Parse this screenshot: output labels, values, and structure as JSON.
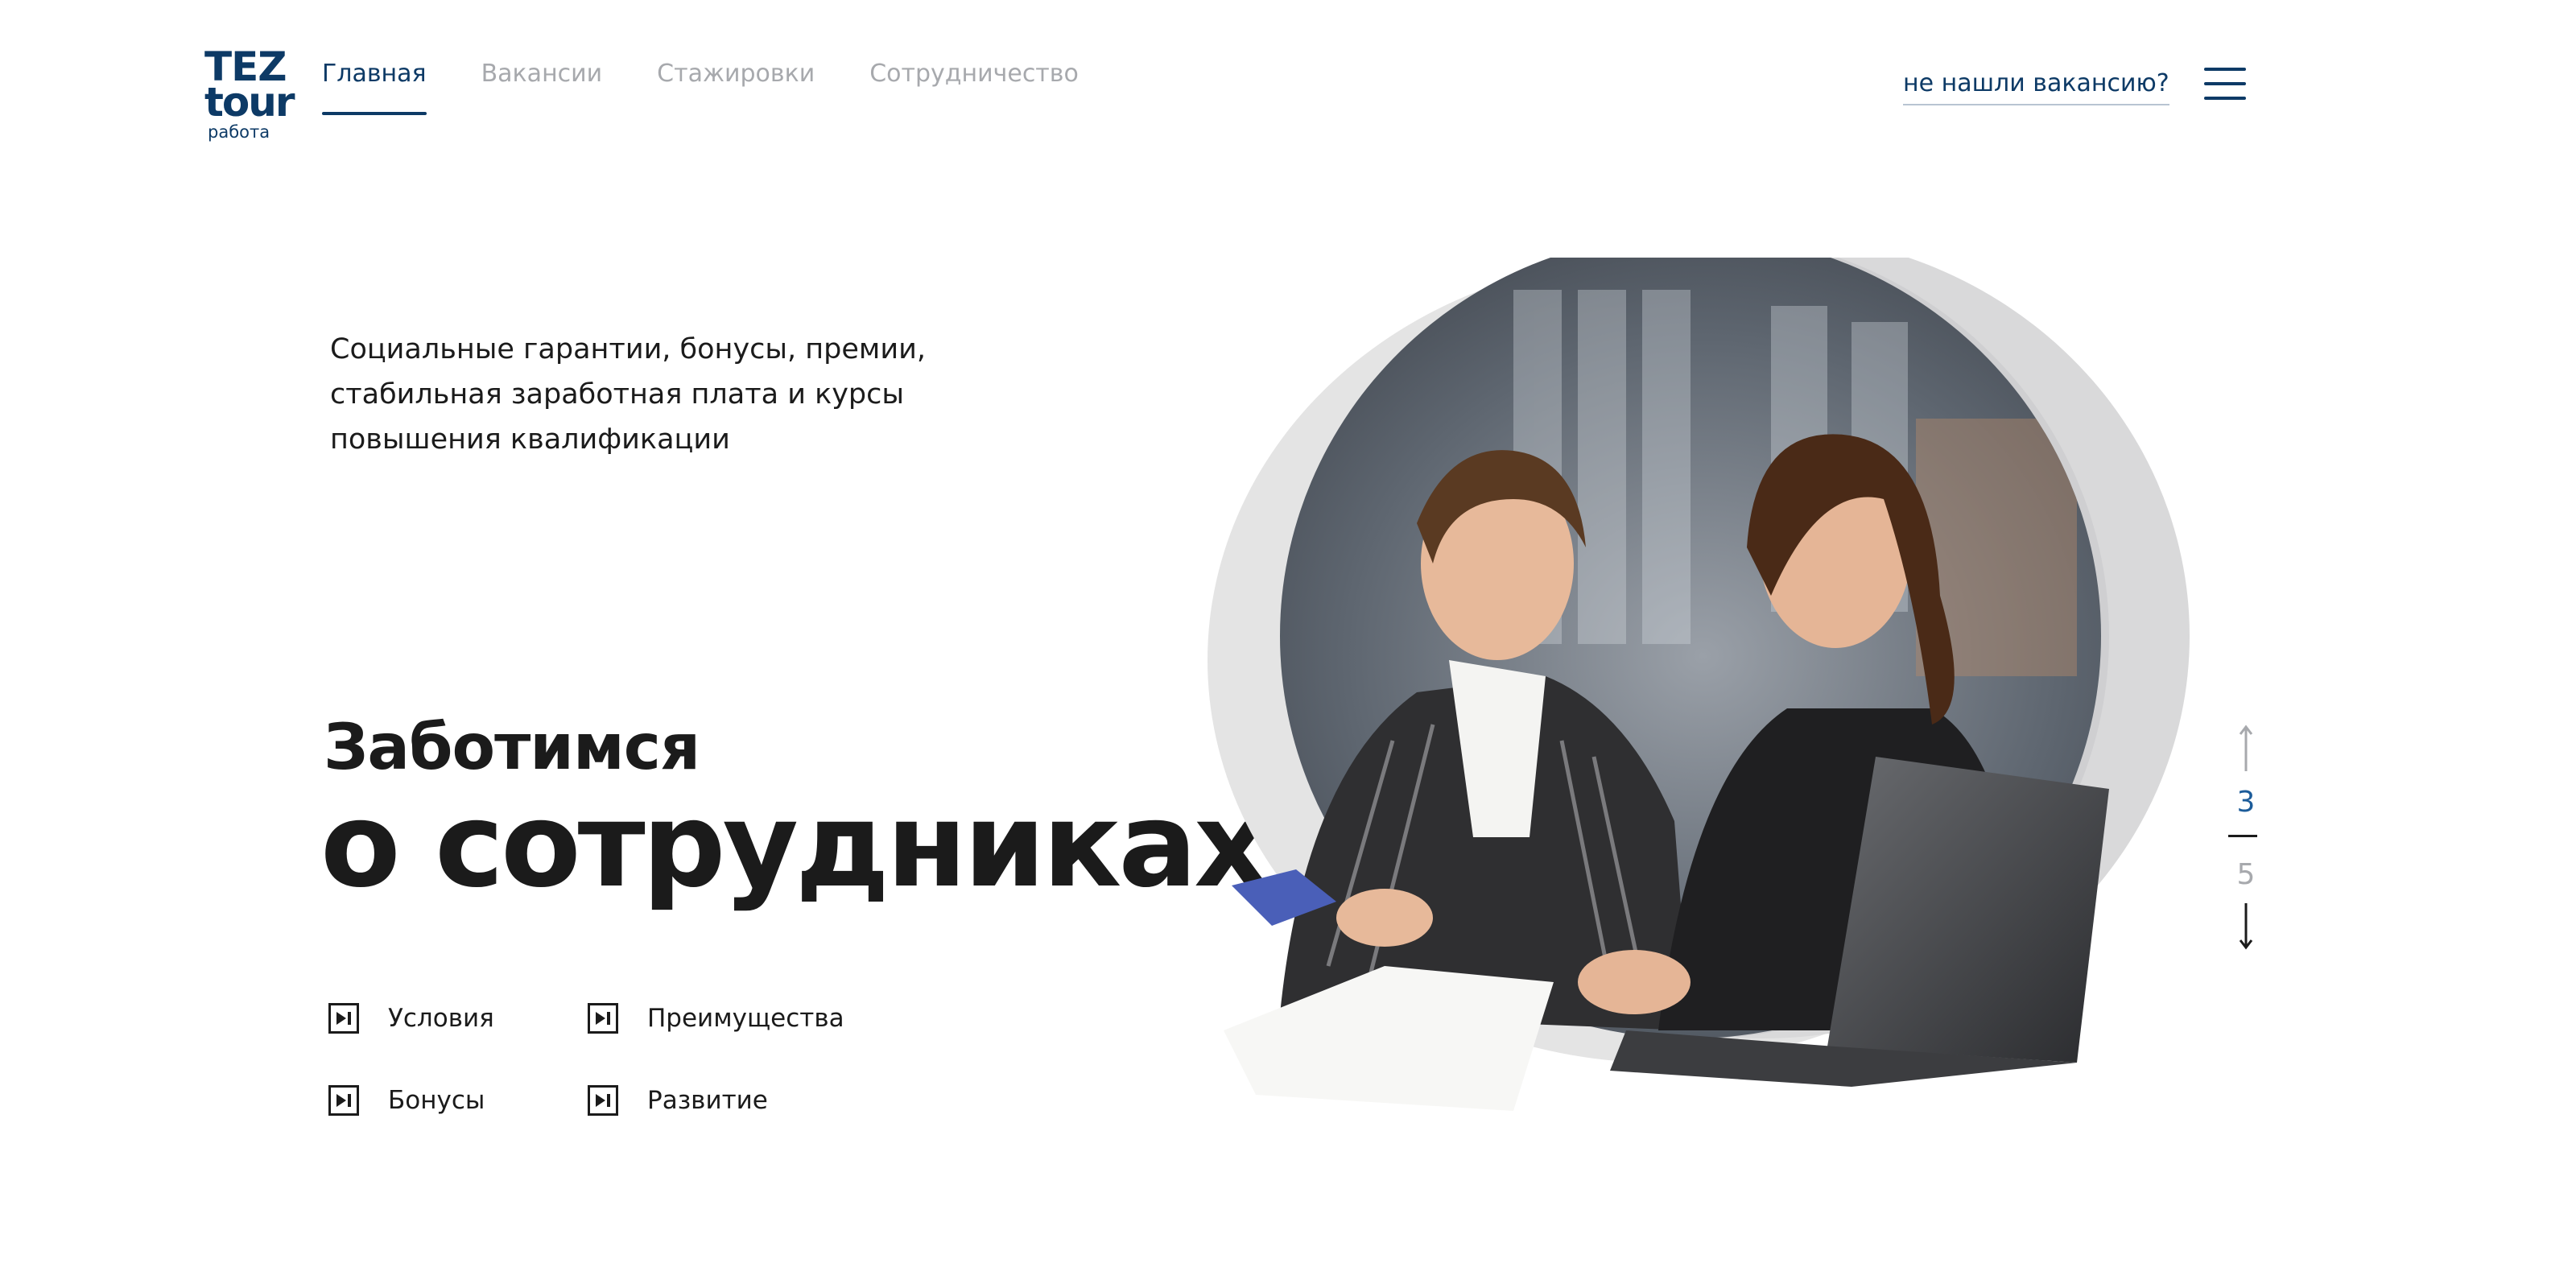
{
  "logo": {
    "line1": "TEZ",
    "line2": "tour",
    "line3": "работа"
  },
  "nav": {
    "items": [
      {
        "label": "Главная",
        "active": true
      },
      {
        "label": "Вакансии",
        "active": false
      },
      {
        "label": "Стажировки",
        "active": false
      },
      {
        "label": "Сотрудничество",
        "active": false
      }
    ]
  },
  "header": {
    "not_found_link": "не нашли вакансию?",
    "menu_icon": "hamburger-menu-icon"
  },
  "hero": {
    "lead": "Социальные гарантии, бонусы, премии,\nстабильная заработная плата и курсы\nповышения квалификации",
    "heading_small": "Заботимся",
    "heading_big": "о сотрудниках",
    "links": [
      {
        "label": "Условия",
        "icon": "play-next-icon"
      },
      {
        "label": "Преимущества",
        "icon": "play-next-icon"
      },
      {
        "label": "Бонусы",
        "icon": "play-next-icon"
      },
      {
        "label": "Развитие",
        "icon": "play-next-icon"
      }
    ],
    "image": "two-businesswomen-with-laptop-photo"
  },
  "pager": {
    "current": "3",
    "total": "5",
    "up_icon": "arrow-up-icon",
    "down_icon": "arrow-down-icon"
  },
  "colors": {
    "brand": "#0d3a66",
    "accent": "#1c5c9a",
    "muted": "#a7a9ad",
    "text": "#1b1b1b"
  }
}
